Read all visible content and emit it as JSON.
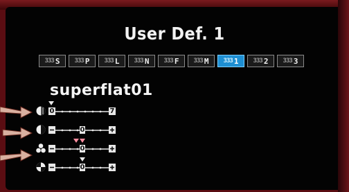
{
  "title": "User Def. 1",
  "style_name": "superflat01",
  "tabs": [
    {
      "glyph": "333",
      "label": "S",
      "active": false
    },
    {
      "glyph": "333",
      "label": "P",
      "active": false
    },
    {
      "glyph": "333",
      "label": "L",
      "active": false
    },
    {
      "glyph": "333",
      "label": "N",
      "active": false
    },
    {
      "glyph": "333",
      "label": "F",
      "active": false
    },
    {
      "glyph": "333",
      "label": "M",
      "active": false
    },
    {
      "glyph": "333",
      "label": "1",
      "active": true
    },
    {
      "glyph": "333",
      "label": "2",
      "active": false
    },
    {
      "glyph": "333",
      "label": "3",
      "active": false
    }
  ],
  "params": [
    {
      "name": "sharpness",
      "icon": "sharpness-icon",
      "left_label": "0",
      "right_label": "7",
      "level": 0.0,
      "kind": "0-7"
    },
    {
      "name": "contrast",
      "icon": "contrast-icon",
      "left_label": "",
      "mid_label": "0",
      "right_label": "",
      "level": 0.0,
      "kind": "centered"
    },
    {
      "name": "saturation",
      "icon": "saturation-icon",
      "left_label": "",
      "mid_label": "0",
      "right_label": "",
      "level": 0.0,
      "kind": "centered",
      "extra_pointers": 2
    },
    {
      "name": "color-tone",
      "icon": "color-tone-icon",
      "left_label": "",
      "mid_label": "0",
      "right_label": "",
      "level": 0.0,
      "kind": "centered"
    }
  ],
  "colors": {
    "screen": "#030303",
    "text": "#f2f2f2",
    "accent": "#1e8fd3",
    "arrow": "#d9b0a0"
  }
}
